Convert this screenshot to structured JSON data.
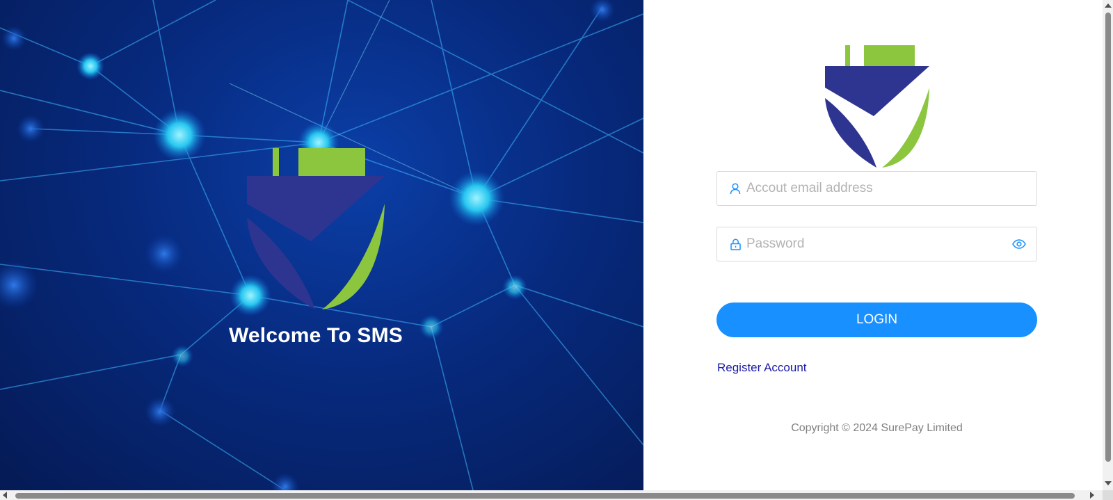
{
  "hero": {
    "title": "Welcome To SMS",
    "background_colors": [
      "#0b3fa8",
      "#072a7e",
      "#051a55"
    ],
    "network_line_color": "#3fd0ff"
  },
  "brand": {
    "logo_icon": "surepay-shield-logo-icon",
    "colors": {
      "navy": "#2e3591",
      "green": "#8cc63f"
    }
  },
  "login_form": {
    "email": {
      "icon": "user-icon",
      "placeholder": "Accout email address",
      "value": ""
    },
    "password": {
      "icon": "lock-icon",
      "placeholder": "Password",
      "value": "",
      "toggle_icon": "eye-icon"
    },
    "login_button_label": "LOGIN",
    "register_link_label": "Register Account",
    "copyright": "Copyright © 2024 SurePay Limited"
  },
  "theme": {
    "accent": "#1890ff",
    "link": "#1a1aa6",
    "muted_text": "#808080"
  }
}
